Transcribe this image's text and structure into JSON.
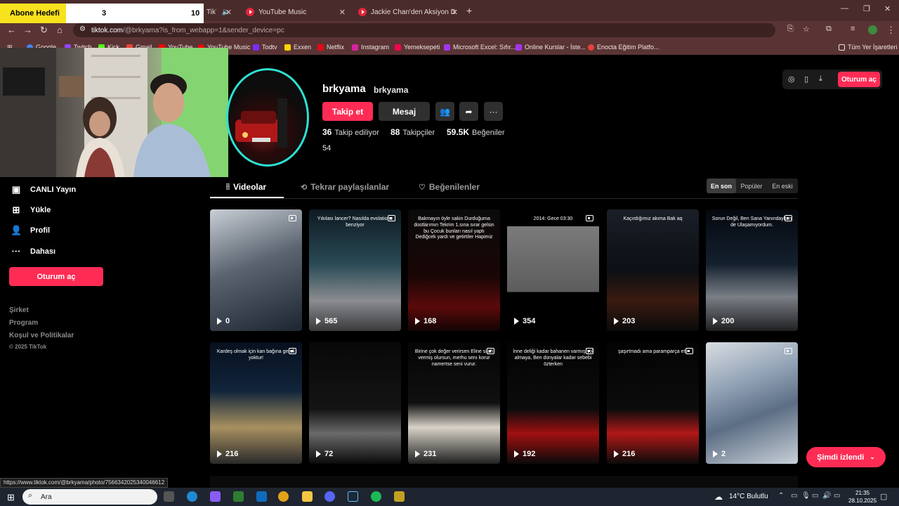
{
  "overlay": {
    "label": "Abone Hedefi",
    "current": "3",
    "target": "10"
  },
  "browser": {
    "tabs": [
      {
        "title": "TikTok"
      },
      {
        "title": "YouTube Music"
      },
      {
        "title": "Jackie Chan'den Aksiyon Dersle"
      }
    ],
    "url_host": "tiktok.com",
    "url_path": "/@brkyama?is_from_webapp=1&sender_device=pc",
    "bookmarks": [
      "Google",
      "Twitch",
      "Kick",
      "Gmail",
      "YouTube",
      "YouTube Music",
      "Todtv",
      "Exxen",
      "Netflix",
      "Instagram",
      "Yemeksepeti",
      "Microsoft Excel: Sıfır...",
      "Online Kurslar - İste...",
      "Enocta Eğitim Platfo..."
    ],
    "all_bookmarks": "Tüm Yer İşaretleri",
    "status_url": "https://www.tiktok.com/@brkyama/photo/7566342025340046612"
  },
  "sidebar": {
    "items": [
      {
        "label": "CANLI Yayın",
        "icon": "live-icon"
      },
      {
        "label": "Yükle",
        "icon": "upload-icon"
      },
      {
        "label": "Profil",
        "icon": "profile-icon"
      },
      {
        "label": "Dahası",
        "icon": "more-icon"
      }
    ],
    "login_label": "Oturum aç",
    "footer": [
      "Şirket",
      "Program",
      "Koşul ve Politikalar",
      "© 2025 TikTok"
    ]
  },
  "profile": {
    "username": "brkyama",
    "nickname": "brkyama",
    "follow_label": "Takip et",
    "message_label": "Mesaj",
    "following_count": "36",
    "following_label": "Takip ediliyor",
    "followers_count": "88",
    "followers_label": "Takipçiler",
    "likes_count": "59.5K",
    "likes_label": "Beğeniler",
    "bio": "54"
  },
  "top_right": {
    "login_label": "Oturum aç"
  },
  "content_tabs": [
    {
      "label": "Videolar"
    },
    {
      "label": "Tekrar paylaşılanlar"
    },
    {
      "label": "Beğenilenler"
    }
  ],
  "sort": {
    "options": [
      "En son",
      "Popüler",
      "En eski"
    ],
    "active": "En son"
  },
  "videos": [
    {
      "views": "0",
      "caption": "",
      "pinned": true
    },
    {
      "views": "565",
      "caption": "Yıkılası lancer? Nasılda evolatione benziyor",
      "pinned": true
    },
    {
      "views": "168",
      "caption": "Bakmayın öyle sakin Durduğuma dostlarımın Tekrim 1.sına sırar gelsin bu Çocuk bunları nasıl yaptı Dediğcek yardı ve getirtiler Hapimiz",
      "pinned": false
    },
    {
      "views": "354",
      "caption": "2014: Gece 03:30",
      "pinned": true
    },
    {
      "views": "203",
      "caption": "Kaçırdığımız akıma Bak aq",
      "pinned": false
    },
    {
      "views": "200",
      "caption": "Sorun Değil, Ben Sana Yanındayken de Ulaşamıyordum.",
      "pinned": true
    },
    {
      "views": "216",
      "caption": "Kardeş olmak için kan bağına gerek yoktur!",
      "pinned": true
    },
    {
      "views": "72",
      "caption": "",
      "pinned": false
    },
    {
      "views": "231",
      "caption": "Birine çok değer verirsen Eline silah vermiş olursun, merhu senı korur namertse seni vurur.",
      "pinned": true
    },
    {
      "views": "192",
      "caption": "İnne deliği kadar bahanen varmış yol almaya, Ben dünyalar kadar sebebi özterken",
      "pinned": true
    },
    {
      "views": "216",
      "caption": "şaşırtmadı ama paramparça etti",
      "pinned": true
    },
    {
      "views": "2",
      "caption": "",
      "pinned": true
    }
  ],
  "watched_button": "Şimdi izlendi",
  "taskbar": {
    "search_placeholder": "Ara",
    "weather": "14°C Bulutlu",
    "time": "21:35",
    "date": "28.10.2025"
  },
  "colors": {
    "accent": "#fe2c55",
    "avatar_ring": "#2de2d4",
    "chrome": "#5a3434"
  }
}
